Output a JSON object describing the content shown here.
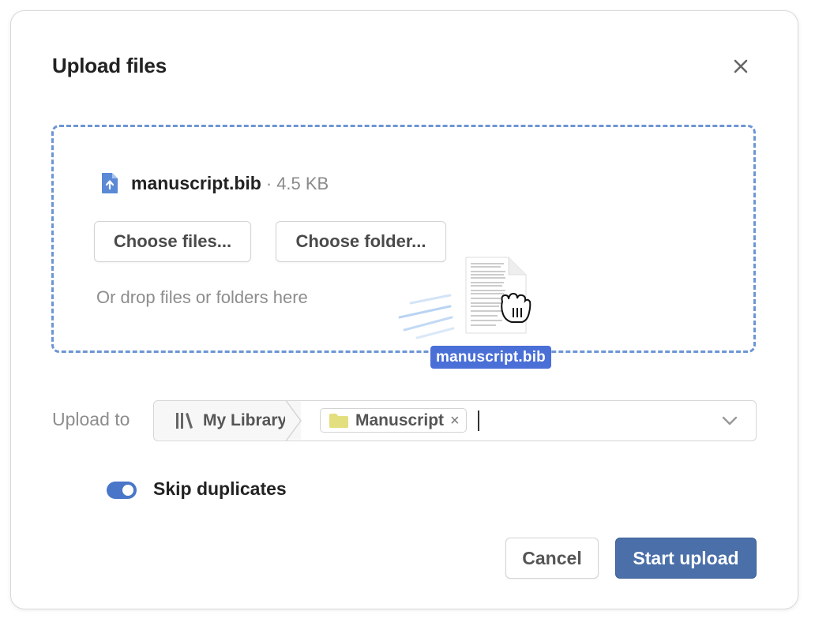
{
  "dialog": {
    "title": "Upload files",
    "close_icon": "close-icon"
  },
  "dropzone": {
    "file": {
      "name": "manuscript.bib",
      "separator": "·",
      "size": "4.5 KB",
      "icon": "file-upload-icon"
    },
    "choose_files_label": "Choose files...",
    "choose_folder_label": "Choose folder...",
    "drop_hint": "Or drop files or folders here",
    "drag": {
      "label": "manuscript.bib",
      "cursor_icon": "grab-hand-icon"
    }
  },
  "destination": {
    "label": "Upload to",
    "root": {
      "label": "My Library",
      "icon": "library-icon"
    },
    "tag": {
      "label": "Manuscript",
      "icon": "folder-icon",
      "remove": "×"
    },
    "chevron_icon": "chevron-down-icon"
  },
  "options": {
    "skip_duplicates": {
      "label": "Skip duplicates",
      "enabled": true
    }
  },
  "actions": {
    "cancel_label": "Cancel",
    "submit_label": "Start upload"
  },
  "colors": {
    "accent": "#4a6fa9",
    "dropzone_border": "#6d95d4",
    "drag_label_bg": "#4a6fd6",
    "folder": "#e3df7e",
    "toggle_on": "#4a76c9"
  }
}
